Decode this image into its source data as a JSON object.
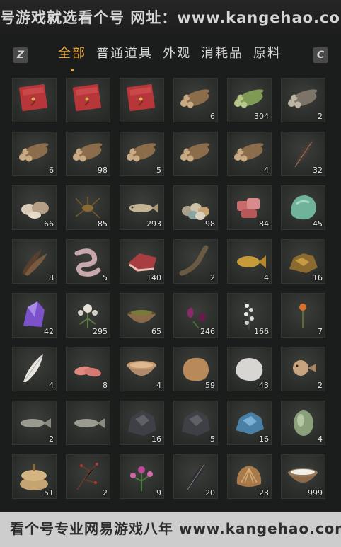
{
  "watermark_top": "号游戏就选看个号  网址：www.kangehao.com",
  "watermark_bottom": "看个号专业网易游戏八年  www.kangehao.com",
  "keys": {
    "left": "Z",
    "right": "C"
  },
  "tabs": [
    {
      "label": "全部",
      "active": true
    },
    {
      "label": "普通道具",
      "active": false
    },
    {
      "label": "外观",
      "active": false
    },
    {
      "label": "消耗品",
      "active": false
    },
    {
      "label": "原料",
      "active": false
    }
  ],
  "items": [
    {
      "icon": "red-envelope-icon",
      "qty": ""
    },
    {
      "icon": "red-envelope-icon",
      "qty": ""
    },
    {
      "icon": "red-envelope-icon",
      "qty": ""
    },
    {
      "icon": "wood-logs-icon",
      "qty": "6"
    },
    {
      "icon": "bamboo-logs-icon",
      "qty": "304"
    },
    {
      "icon": "grey-logs-icon",
      "qty": "2"
    },
    {
      "icon": "wood-logs-icon",
      "qty": "6"
    },
    {
      "icon": "wood-logs-icon",
      "qty": "98"
    },
    {
      "icon": "wood-logs-icon",
      "qty": "5"
    },
    {
      "icon": "wood-logs-icon",
      "qty": ""
    },
    {
      "icon": "wood-logs-icon",
      "qty": "4"
    },
    {
      "icon": "feather-icon",
      "qty": "32"
    },
    {
      "icon": "shells-icon",
      "qty": "66"
    },
    {
      "icon": "insect-icon",
      "qty": "85"
    },
    {
      "icon": "fish-icon",
      "qty": "293"
    },
    {
      "icon": "eggs-icon",
      "qty": "98"
    },
    {
      "icon": "raw-meat-icon",
      "qty": "84"
    },
    {
      "icon": "jade-stone-icon",
      "qty": "45"
    },
    {
      "icon": "feathers-bundle-icon",
      "qty": "8"
    },
    {
      "icon": "intestine-icon",
      "qty": "5"
    },
    {
      "icon": "meat-slab-icon",
      "qty": "140"
    },
    {
      "icon": "eel-icon",
      "qty": "2"
    },
    {
      "icon": "carp-icon",
      "qty": "4"
    },
    {
      "icon": "gold-ore-icon",
      "qty": "16"
    },
    {
      "icon": "purple-crystal-icon",
      "qty": "42"
    },
    {
      "icon": "white-flower-icon",
      "qty": "295"
    },
    {
      "icon": "herb-bowl-icon",
      "qty": "65"
    },
    {
      "icon": "purple-flower-icon",
      "qty": "246"
    },
    {
      "icon": "white-blossom-icon",
      "qty": "166"
    },
    {
      "icon": "orange-flower-icon",
      "qty": "7"
    },
    {
      "icon": "white-feather-icon",
      "qty": "4"
    },
    {
      "icon": "fish-fillet-icon",
      "qty": "8"
    },
    {
      "icon": "soup-bowl-icon",
      "qty": "4"
    },
    {
      "icon": "fur-pelt-icon",
      "qty": "59"
    },
    {
      "icon": "white-pelt-icon",
      "qty": "43"
    },
    {
      "icon": "pufferfish-icon",
      "qty": "2"
    },
    {
      "icon": "grey-fish-icon",
      "qty": "2"
    },
    {
      "icon": "grey-fish-icon",
      "qty": ""
    },
    {
      "icon": "dark-ore-icon",
      "qty": "16"
    },
    {
      "icon": "dark-ore-icon",
      "qty": "5"
    },
    {
      "icon": "blue-ore-icon",
      "qty": "16"
    },
    {
      "icon": "gourd-icon",
      "qty": "4"
    },
    {
      "icon": "rice-sacks-icon",
      "qty": "51"
    },
    {
      "icon": "red-twigs-icon",
      "qty": "2"
    },
    {
      "icon": "pink-flowers-icon",
      "qty": "9"
    },
    {
      "icon": "dark-feather-icon",
      "qty": "20"
    },
    {
      "icon": "shell-icon",
      "qty": "23"
    },
    {
      "icon": "salt-bowl-icon",
      "qty": "999"
    }
  ]
}
